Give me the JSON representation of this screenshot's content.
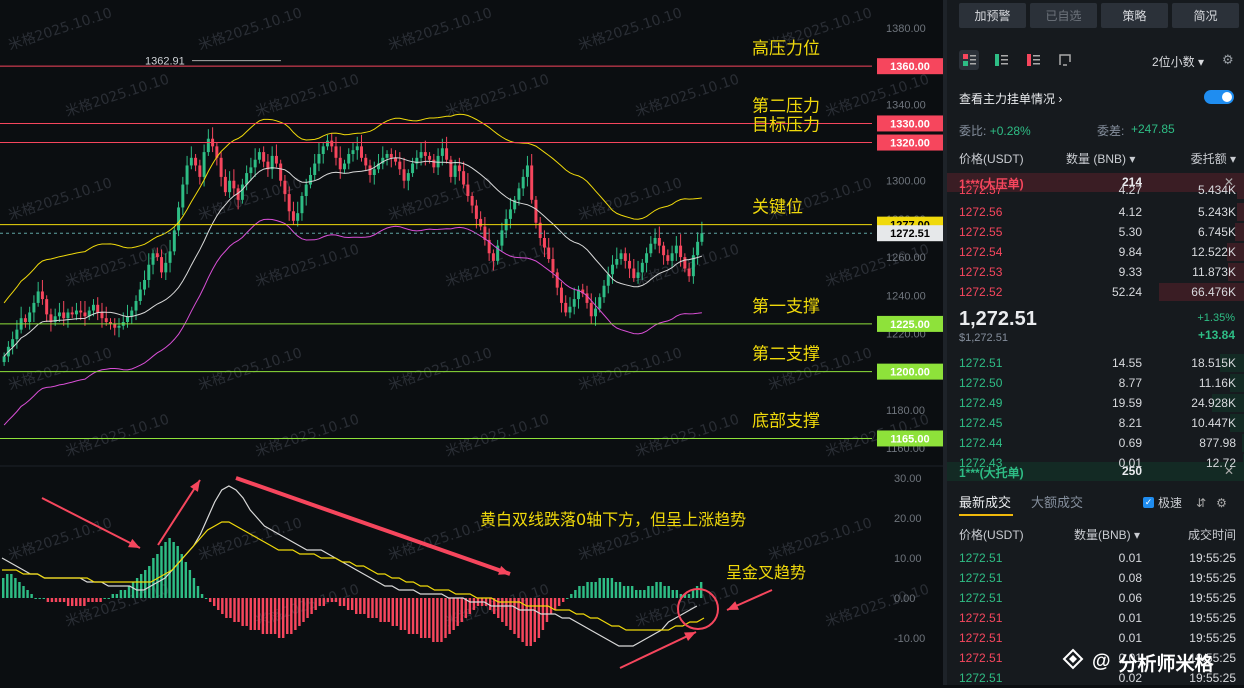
{
  "chart_data": [
    {
      "type": "candlestick",
      "title": "",
      "y_axis": {
        "ylim": [
          1160,
          1385
        ],
        "ticks": [
          1380,
          1360,
          1340,
          1320,
          1300,
          1280,
          1260,
          1240,
          1220,
          1200,
          1180,
          1160
        ]
      },
      "high_marker": {
        "label": "1362.91",
        "value": 1362.91
      },
      "horizontal_levels": [
        {
          "value": 1360.0,
          "label": "1360.00",
          "note": "高压力位",
          "color": "#f6465d"
        },
        {
          "value": 1330.0,
          "label": "1330.00",
          "note": "第二压力",
          "color": "#f6465d"
        },
        {
          "value": 1320.0,
          "label": "1320.00",
          "note": "目标压力",
          "color": "#f6465d"
        },
        {
          "value": 1277.0,
          "label": "1277.00",
          "note": "关键位",
          "color": "#f0d90b"
        },
        {
          "value": 1225.0,
          "label": "1225.00",
          "note": "第一支撑",
          "color": "#8ee23a"
        },
        {
          "value": 1200.0,
          "label": "1200.00",
          "note": "第二支撑",
          "color": "#8ee23a"
        },
        {
          "value": 1165.0,
          "label": "1165.00",
          "note": "底部支撑",
          "color": "#8ee23a"
        }
      ],
      "current_price": {
        "value": 1272.51,
        "label": "1272.51"
      },
      "candles_close": [
        1208,
        1213,
        1217,
        1222,
        1228,
        1226,
        1231,
        1236,
        1242,
        1238,
        1230,
        1226,
        1229,
        1231,
        1228,
        1231,
        1230,
        1232,
        1231,
        1229,
        1232,
        1235,
        1231,
        1228,
        1226,
        1225,
        1223,
        1224,
        1226,
        1229,
        1232,
        1237,
        1243,
        1248,
        1256,
        1262,
        1260,
        1252,
        1257,
        1263,
        1274,
        1286,
        1298,
        1308,
        1312,
        1308,
        1302,
        1315,
        1322,
        1318,
        1312,
        1302,
        1294,
        1300,
        1296,
        1290,
        1298,
        1304,
        1307,
        1311,
        1315,
        1310,
        1306,
        1313,
        1309,
        1300,
        1293,
        1284,
        1279,
        1283,
        1292,
        1298,
        1303,
        1309,
        1314,
        1318,
        1321,
        1318,
        1312,
        1306,
        1309,
        1314,
        1316,
        1318,
        1312,
        1308,
        1303,
        1306,
        1309,
        1312,
        1314,
        1312,
        1310,
        1306,
        1300,
        1304,
        1309,
        1312,
        1315,
        1313,
        1311,
        1307,
        1313,
        1317,
        1311,
        1302,
        1308,
        1305,
        1298,
        1292,
        1287,
        1280,
        1276,
        1269,
        1262,
        1258,
        1266,
        1274,
        1280,
        1285,
        1290,
        1296,
        1302,
        1308,
        1290,
        1278,
        1270,
        1265,
        1259,
        1252,
        1244,
        1236,
        1231,
        1234,
        1238,
        1243,
        1241,
        1236,
        1229,
        1233,
        1239,
        1245,
        1251,
        1256,
        1259,
        1262,
        1258,
        1254,
        1249,
        1252,
        1257,
        1262,
        1267,
        1270,
        1266,
        1261,
        1258,
        1262,
        1266,
        1260,
        1254,
        1250,
        1261,
        1268,
        1272.51
      ],
      "macd": {
        "ylim": [
          -14,
          33
        ],
        "ticks": [
          30.0,
          20.0,
          10.0,
          0.0,
          -10.0
        ],
        "histogram": [
          5,
          6,
          6,
          5,
          4,
          3,
          2,
          1,
          0,
          0,
          0,
          -1,
          -1,
          -1,
          -1,
          -1,
          -2,
          -2,
          -2,
          -2,
          -2,
          -1,
          -1,
          -1,
          -1,
          0,
          0,
          1,
          1,
          2,
          2,
          3,
          4,
          5,
          6,
          7,
          8,
          10,
          11,
          13,
          14,
          15,
          14,
          13,
          11,
          9,
          7,
          5,
          3,
          1,
          0,
          -1,
          -2,
          -3,
          -4,
          -5,
          -5,
          -6,
          -6,
          -7,
          -7,
          -8,
          -8,
          -8,
          -9,
          -9,
          -9,
          -9,
          -10,
          -10,
          -9,
          -9,
          -8,
          -7,
          -6,
          -5,
          -4,
          -3,
          -2,
          -2,
          -1,
          -1,
          -1,
          -2,
          -2,
          -3,
          -3,
          -4,
          -4,
          -4,
          -5,
          -5,
          -5,
          -6,
          -6,
          -6,
          -7,
          -7,
          -8,
          -8,
          -9,
          -9,
          -9,
          -10,
          -10,
          -10,
          -11,
          -11,
          -11,
          -10,
          -9,
          -8,
          -7,
          -6,
          -5,
          -4,
          -3,
          -2,
          -2,
          -2,
          -3,
          -4,
          -5,
          -6,
          -7,
          -8,
          -9,
          -10,
          -11,
          -12,
          -12,
          -11,
          -10,
          -8,
          -6,
          -4,
          -3,
          -2,
          -1,
          0,
          1,
          2,
          3,
          3,
          4,
          4,
          4,
          5,
          5,
          5,
          5,
          4,
          4,
          3,
          3,
          3,
          2,
          2,
          2,
          3,
          3,
          4,
          4,
          3,
          3,
          2,
          2,
          1,
          1,
          1,
          2,
          3,
          4
        ],
        "dif": [
          10,
          9,
          8,
          7,
          6,
          6,
          5,
          5,
          5,
          5,
          5,
          5,
          4,
          4,
          4,
          3,
          3,
          3,
          3,
          2,
          2,
          3,
          4,
          5,
          7,
          9,
          11,
          13,
          16,
          20,
          24,
          27,
          28,
          27,
          25,
          22,
          20,
          18,
          17,
          16,
          15,
          14,
          13,
          12,
          12,
          12,
          11,
          10,
          9,
          8,
          7,
          6,
          5,
          4,
          3,
          3,
          2,
          2,
          2,
          1,
          1,
          1,
          1,
          0,
          0,
          0,
          -1,
          -1,
          -1,
          -2,
          -2,
          -2,
          -2,
          -3,
          -3,
          -3,
          -4,
          -4,
          -4,
          -5,
          -5,
          -6,
          -7,
          -8,
          -9,
          -10,
          -11,
          -12,
          -12,
          -12,
          -11,
          -10,
          -9,
          -8,
          -6,
          -5,
          -4,
          -3,
          -2
        ],
        "dea": [
          7,
          7,
          7,
          6,
          6,
          6,
          5,
          5,
          5,
          5,
          5,
          5,
          5,
          4,
          4,
          4,
          4,
          4,
          4,
          4,
          4,
          4,
          5,
          6,
          7,
          9,
          11,
          13,
          15,
          17,
          18,
          19,
          19,
          18,
          17,
          16,
          15,
          14,
          13,
          12,
          12,
          12,
          11,
          11,
          11,
          10,
          10,
          10,
          9,
          9,
          8,
          8,
          7,
          6,
          6,
          5,
          5,
          4,
          4,
          3,
          3,
          2,
          2,
          2,
          1,
          1,
          1,
          0,
          0,
          0,
          -1,
          -1,
          -1,
          -1,
          -2,
          -2,
          -2,
          -2,
          -3,
          -3,
          -3,
          -4,
          -4,
          -5,
          -5,
          -6,
          -7,
          -7,
          -8,
          -8,
          -8,
          -8,
          -8,
          -8,
          -8,
          -7,
          -7,
          -6,
          -6,
          -5
        ]
      },
      "annotations": {
        "macd_text": "黄白双线跌落0轴下方，但呈上涨趋势",
        "cross_text": "呈金叉趋势"
      },
      "watermark": "米格2025.10.10"
    }
  ],
  "panel": {
    "buttons": [
      "加预警",
      "已自选",
      "策略",
      "简况"
    ],
    "precision": "2位小数",
    "main_orders_label": "查看主力挂单情况",
    "commission_ratio_label": "委比:",
    "commission_ratio": "+0.28%",
    "commission_diff_label": "委差:",
    "commission_diff": "+247.85",
    "ob_headers": {
      "price": "价格(USDT)",
      "qty": "数量 (BNB)",
      "total": "委托额"
    },
    "big_ask": {
      "label": "1***(大压单)",
      "qty": "214"
    },
    "asks": [
      {
        "price": "1272.57",
        "qty": "4.27",
        "total": "5.434K",
        "depth": 0.08
      },
      {
        "price": "1272.56",
        "qty": "4.12",
        "total": "5.243K",
        "depth": 0.08
      },
      {
        "price": "1272.55",
        "qty": "5.30",
        "total": "6.745K",
        "depth": 0.1
      },
      {
        "price": "1272.54",
        "qty": "9.84",
        "total": "12.522K",
        "depth": 0.2
      },
      {
        "price": "1272.53",
        "qty": "9.33",
        "total": "11.873K",
        "depth": 0.19
      },
      {
        "price": "1272.52",
        "qty": "52.24",
        "total": "66.476K",
        "depth": 1.0
      }
    ],
    "last_price": "1,272.51",
    "last_price_usd": "$1,272.51",
    "change_pct": "+1.35%",
    "change_abs": "+13.84",
    "bids": [
      {
        "price": "1272.51",
        "qty": "14.55",
        "total": "18.515K",
        "depth": 0.28
      },
      {
        "price": "1272.50",
        "qty": "8.77",
        "total": "11.16K",
        "depth": 0.17
      },
      {
        "price": "1272.49",
        "qty": "19.59",
        "total": "24.928K",
        "depth": 0.38
      },
      {
        "price": "1272.45",
        "qty": "8.21",
        "total": "10.447K",
        "depth": 0.16
      },
      {
        "price": "1272.44",
        "qty": "0.69",
        "total": "877.98",
        "depth": 0.02
      },
      {
        "price": "1272.43",
        "qty": "0.01",
        "total": "12.72",
        "depth": 0.01
      }
    ],
    "big_bid": {
      "label": "1***(大托单)",
      "qty": "250"
    },
    "trade_tabs": [
      "最新成交",
      "大额成交"
    ],
    "speed_label": "极速",
    "trade_headers": {
      "price": "价格(USDT)",
      "qty": "数量(BNB)",
      "time": "成交时间"
    },
    "trades": [
      {
        "price": "1272.51",
        "qty": "0.01",
        "time": "19:55:25",
        "side": "buy"
      },
      {
        "price": "1272.51",
        "qty": "0.08",
        "time": "19:55:25",
        "side": "buy"
      },
      {
        "price": "1272.51",
        "qty": "0.06",
        "time": "19:55:25",
        "side": "buy"
      },
      {
        "price": "1272.51",
        "qty": "0.01",
        "time": "19:55:25",
        "side": "sell"
      },
      {
        "price": "1272.51",
        "qty": "0.01",
        "time": "19:55:25",
        "side": "sell"
      },
      {
        "price": "1272.51",
        "qty": "0.01",
        "time": "19:55:25",
        "side": "sell"
      },
      {
        "price": "1272.51",
        "qty": "0.02",
        "time": "19:55:25",
        "side": "buy"
      }
    ],
    "brand": "分析师米格"
  }
}
